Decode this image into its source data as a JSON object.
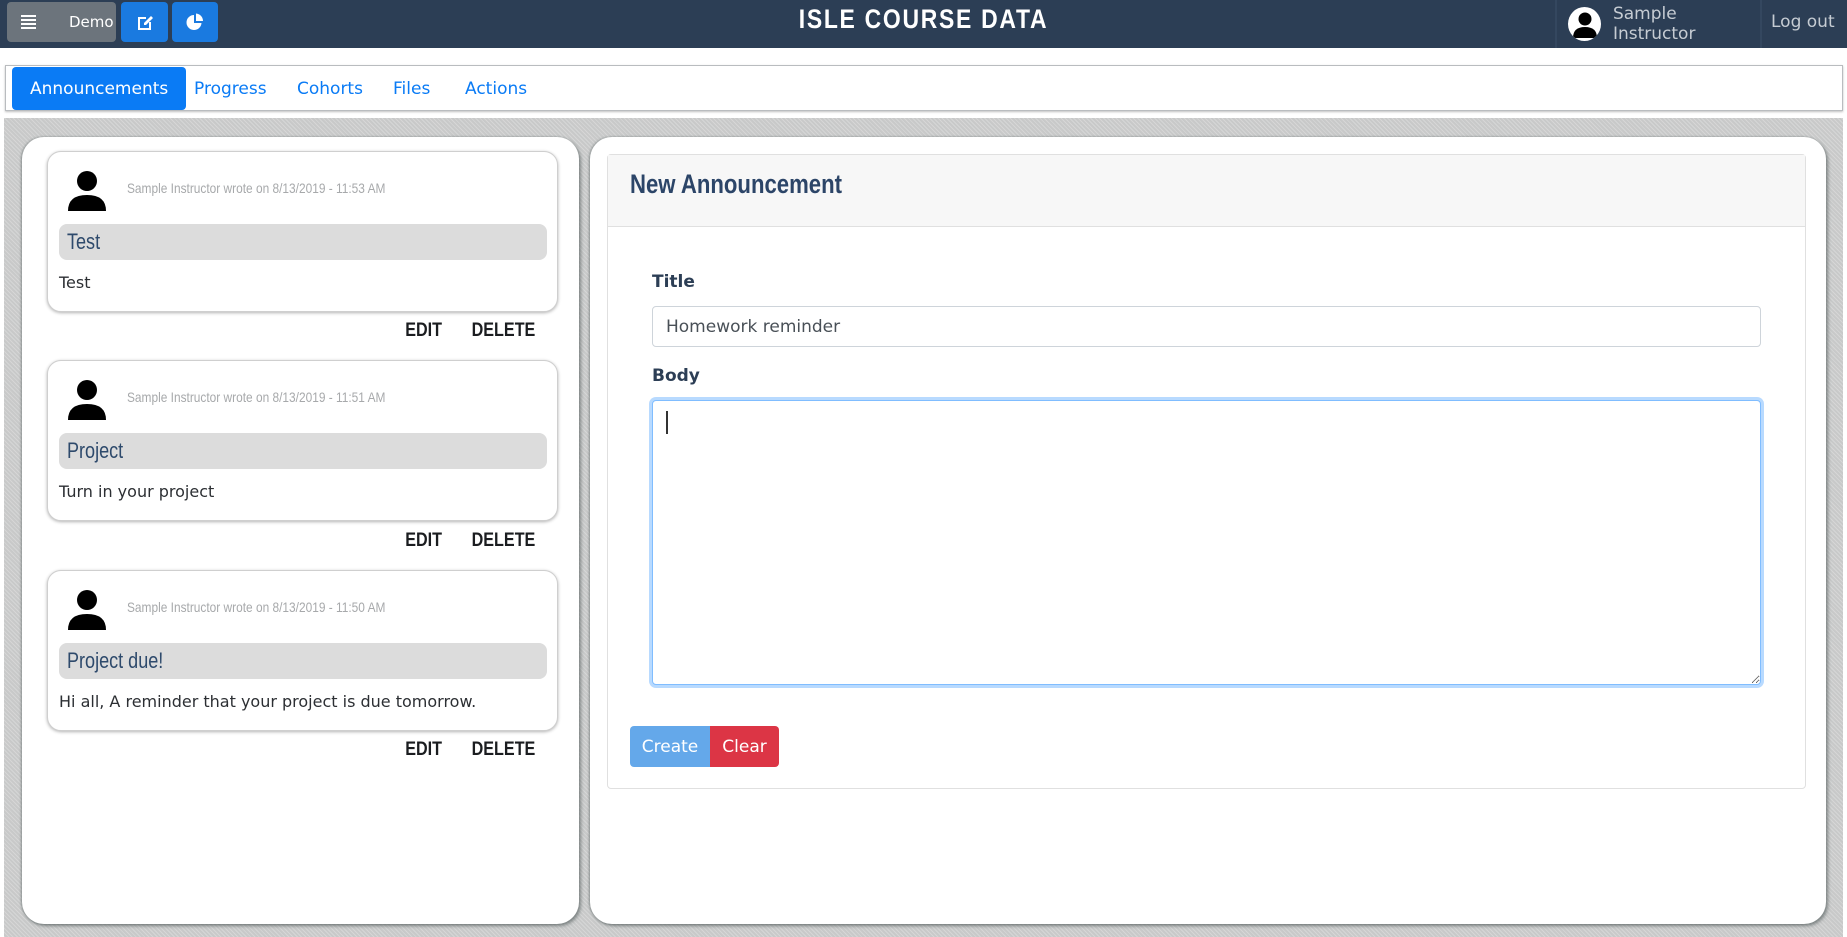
{
  "header": {
    "menu_label": "Demo",
    "title": "ISLE COURSE DATA",
    "user_name": "Sample Instructor",
    "logout_label": "Log out",
    "icons": [
      "menu-icon",
      "edit-icon",
      "pie-chart-icon",
      "user-avatar-icon"
    ]
  },
  "tabs": [
    {
      "label": "Announcements",
      "active": true
    },
    {
      "label": "Progress",
      "active": false
    },
    {
      "label": "Cohorts",
      "active": false
    },
    {
      "label": "Files",
      "active": false
    },
    {
      "label": "Actions",
      "active": false
    }
  ],
  "announcements": [
    {
      "meta": "Sample Instructor wrote on 8/13/2019 - 11:53 AM",
      "title": "Test",
      "body": "Test",
      "edit_label": "EDIT",
      "delete_label": "DELETE"
    },
    {
      "meta": "Sample Instructor wrote on 8/13/2019 - 11:51 AM",
      "title": "Project",
      "body": "Turn in your project",
      "edit_label": "EDIT",
      "delete_label": "DELETE"
    },
    {
      "meta": "Sample Instructor wrote on 8/13/2019 - 11:50 AM",
      "title": "Project due!",
      "body": "Hi all, A reminder that your project is due tomorrow.",
      "edit_label": "EDIT",
      "delete_label": "DELETE"
    }
  ],
  "form": {
    "heading": "New Announcement",
    "title_label": "Title",
    "title_value": "Homework reminder",
    "body_label": "Body",
    "body_value": "",
    "create_label": "Create",
    "clear_label": "Clear"
  },
  "colors": {
    "header_bg": "#2c3e55",
    "primary": "#0a7bf5",
    "danger": "#dc3545",
    "create_disabled": "#64a8ea"
  }
}
